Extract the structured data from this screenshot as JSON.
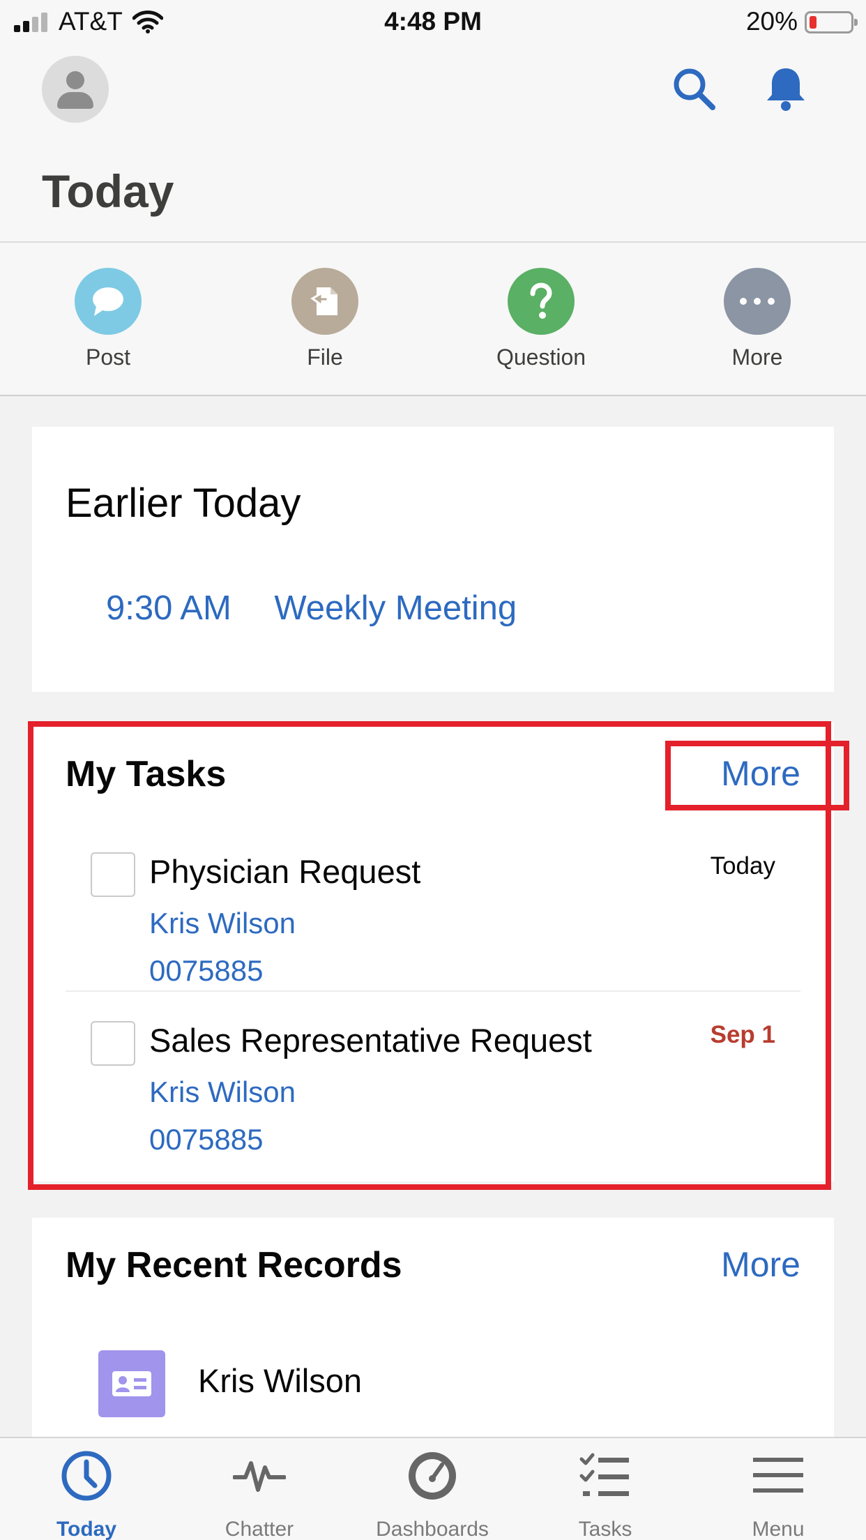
{
  "status_bar": {
    "carrier": "AT&T",
    "time": "4:48 PM",
    "battery": "20%"
  },
  "header": {
    "title": "Today",
    "icons": [
      "avatar",
      "search-icon",
      "notification-bell-icon"
    ]
  },
  "actions": [
    {
      "label": "Post",
      "icon": "post-icon",
      "color": "#7ecae4"
    },
    {
      "label": "File",
      "icon": "file-icon",
      "color": "#b8ab99"
    },
    {
      "label": "Question",
      "icon": "question-icon",
      "color": "#5ab064"
    },
    {
      "label": "More",
      "icon": "more-icon",
      "color": "#8b95a3"
    }
  ],
  "earlier_today": {
    "title": "Earlier Today",
    "event_time": "9:30 AM",
    "event_name": "Weekly Meeting"
  },
  "my_tasks": {
    "title": "My Tasks",
    "more_label": "More",
    "tasks": [
      {
        "title": "Physician Request",
        "name": "Kris Wilson",
        "number": "0075885",
        "date": "Today",
        "overdue": false
      },
      {
        "title": "Sales Representative Request",
        "name": "Kris Wilson",
        "number": "0075885",
        "date": "Sep 1",
        "overdue": true
      }
    ]
  },
  "recent_records": {
    "title": "My Recent Records",
    "more_label": "More",
    "records": [
      {
        "name": "Kris Wilson",
        "icon": "contact-card-icon",
        "color": "#a094ed"
      }
    ]
  },
  "tab_bar": {
    "tabs": [
      {
        "label": "Today",
        "icon": "clock-icon",
        "active": true
      },
      {
        "label": "Chatter",
        "icon": "pulse-icon",
        "active": false
      },
      {
        "label": "Dashboards",
        "icon": "gauge-icon",
        "active": false
      },
      {
        "label": "Tasks",
        "icon": "checklist-icon",
        "active": false
      },
      {
        "label": "Menu",
        "icon": "hamburger-icon",
        "active": false
      }
    ]
  },
  "colors": {
    "link": "#2d6ac0",
    "highlight": "#e4202a",
    "overdue": "#b83c2e"
  }
}
